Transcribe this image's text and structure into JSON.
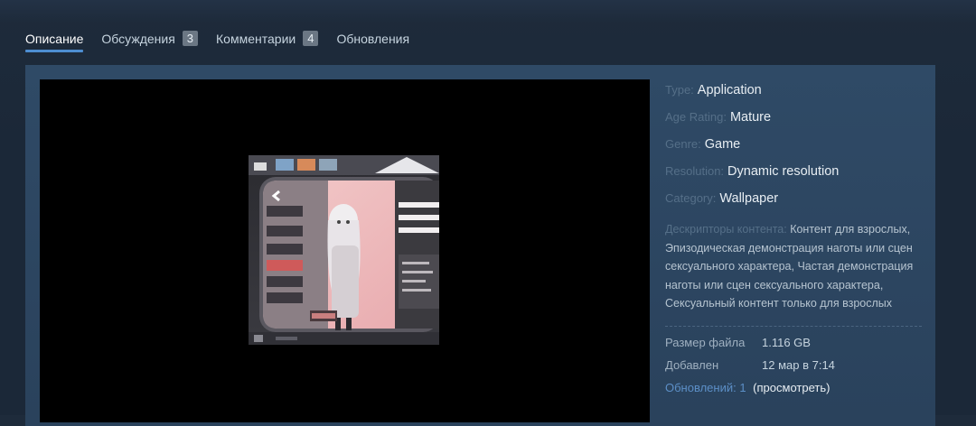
{
  "tabs": [
    {
      "label": "Описание",
      "active": true
    },
    {
      "label": "Обсуждения",
      "count": "3"
    },
    {
      "label": "Комментарии",
      "count": "4"
    },
    {
      "label": "Обновления"
    }
  ],
  "details": {
    "type": {
      "key": "Type:",
      "value": "Application"
    },
    "age_rating": {
      "key": "Age Rating:",
      "value": "Mature"
    },
    "genre": {
      "key": "Genre:",
      "value": "Game"
    },
    "resolution": {
      "key": "Resolution:",
      "value": "Dynamic resolution"
    },
    "category": {
      "key": "Category:",
      "value": "Wallpaper"
    },
    "descriptors": {
      "key": "Дескрипторы контента:",
      "value": "Контент для взрослых, Эпизодическая демонстрация наготы или сцен сексуального характера, Частая демонстрация наготы или сцен сексуального характера, Сексуальный контент только для взрослых"
    }
  },
  "stats": {
    "file_size": {
      "key": "Размер файла",
      "value": "1.116 GB"
    },
    "added": {
      "key": "Добавлен",
      "value": "12 мар в 7:14"
    },
    "updates": {
      "key": "Обновлений: 1",
      "view_label": "(просмотреть)"
    }
  },
  "colors": {
    "accent": "#4d8dd1",
    "panel": "#2f4a66",
    "background": "#1b2838"
  }
}
